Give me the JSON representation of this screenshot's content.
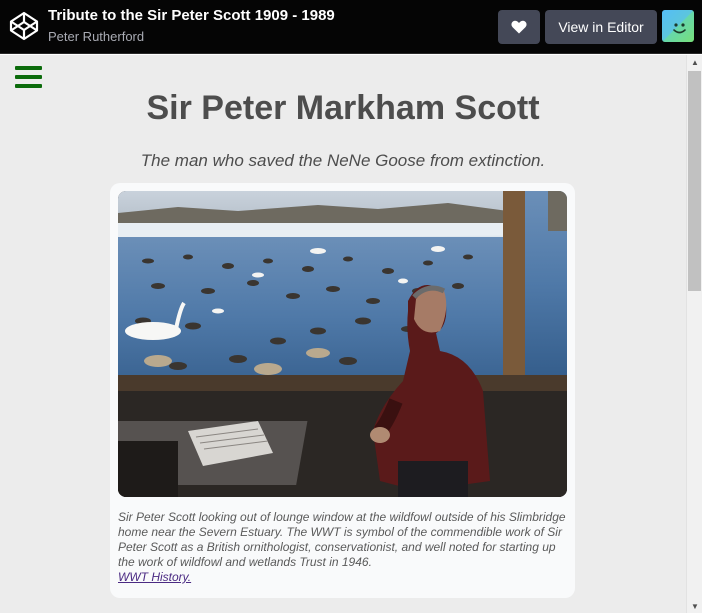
{
  "header": {
    "title": "Tribute to the Sir Peter Scott 1909 - 1989",
    "author": "Peter Rutherford",
    "heart_icon": "heart-icon",
    "editor_label": "View in Editor"
  },
  "page": {
    "heading": "Sir Peter Markham Scott",
    "tagline": "The man who saved the NeNe Goose from extinction.",
    "caption": "Sir Peter Scott looking out of lounge window at the wildfowl outside of his Slimbridge home near the Severn Estuary. The WWT is symbol of the commendible work of Sir Peter Scott as a British ornithologist, conservationist, and well noted for starting up the work of wildfowl and wetlands Trust in 1946.",
    "link_label": "WWT History."
  },
  "colors": {
    "topbar": "#050505",
    "button": "#444857",
    "content_bg": "#ececec",
    "heading_text": "#4d4d4d",
    "menu_icon": "#0b6b0b",
    "link": "#4b2a83"
  }
}
